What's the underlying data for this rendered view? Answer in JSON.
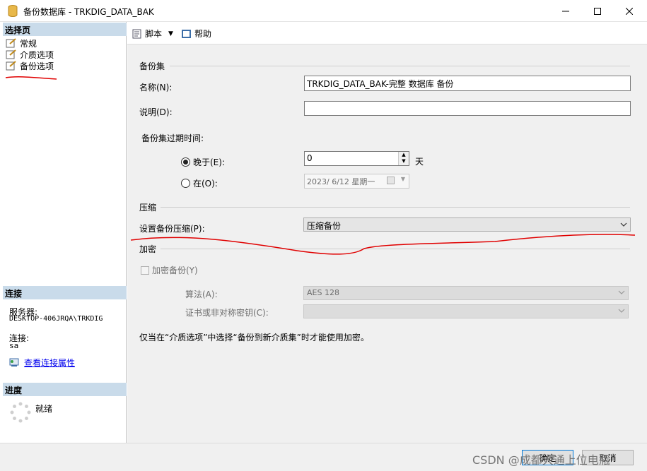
{
  "window": {
    "title": "备份数据库 - TRKDIG_DATA_BAK",
    "minimize_icon": "minimize-icon",
    "maximize_icon": "maximize-icon",
    "close_icon": "close-icon"
  },
  "left": {
    "select_page_header": "选择页",
    "pages": [
      {
        "label": "常规",
        "icon": "page-icon"
      },
      {
        "label": "介质选项",
        "icon": "page-icon"
      },
      {
        "label": "备份选项",
        "icon": "page-icon"
      }
    ],
    "connection_header": "连接",
    "server_label": "服务器:",
    "server_value": "DESKTOP-406JRQA\\TRKDIG",
    "connection_label": "连接:",
    "connection_value": "sa",
    "view_connection_link": "查看连接属性",
    "progress_header": "进度",
    "progress_status": "就绪"
  },
  "toolbar": {
    "script_label": "脚本",
    "help_label": "帮助"
  },
  "backup_set": {
    "group_title": "备份集",
    "name_label": "名称(N):",
    "name_value": "TRKDIG_DATA_BAK-完整 数据库 备份",
    "description_label": "说明(D):",
    "description_value": "",
    "expire_label": "备份集过期时间:",
    "after_label": "晚于(E):",
    "after_value": "0",
    "after_unit": "天",
    "on_label": "在(O):",
    "on_value": "2023/ 6/12 星期一",
    "selected": "after"
  },
  "compression": {
    "group_title": "压缩",
    "set_label": "设置备份压缩(P):",
    "selected_value": "压缩备份"
  },
  "encryption": {
    "group_title": "加密",
    "encrypt_label": "加密备份(Y)",
    "algorithm_label": "算法(A):",
    "algorithm_value": "AES 128",
    "cert_label": "证书或非对称密钥(C):",
    "cert_value": "",
    "note": "仅当在“介质选项”中选择“备份到新介质集”时才能使用加密。"
  },
  "buttons": {
    "ok": "确定",
    "cancel": "取消"
  },
  "watermark": "CSDN @成都大通上位电瓶"
}
